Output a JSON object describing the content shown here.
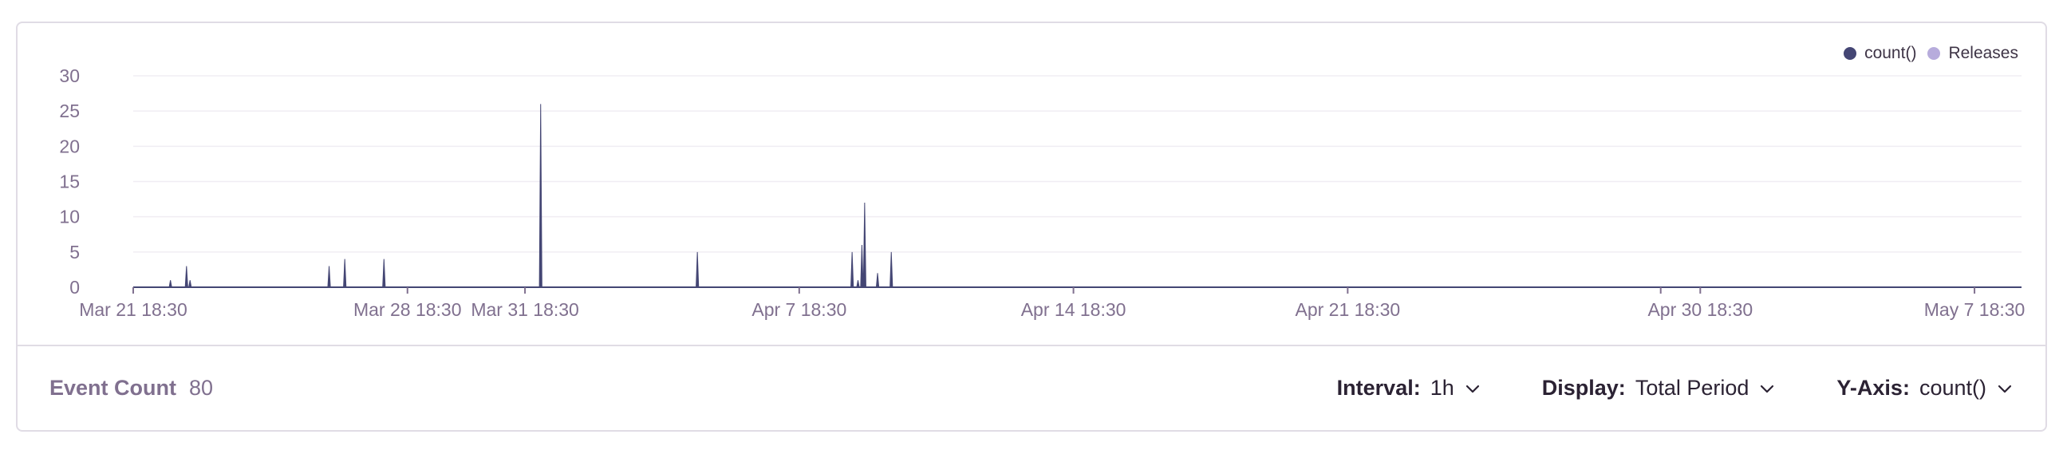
{
  "chart_data": {
    "type": "area",
    "title": "",
    "xlabel": "",
    "ylabel": "",
    "ylim": [
      0,
      30
    ],
    "y_ticks": [
      "30",
      "25",
      "20",
      "15",
      "10",
      "5",
      "0"
    ],
    "x_tick_labels": [
      "Mar 21 18:30",
      "Mar 28 18:30",
      "Mar 31 18:30",
      "Apr 7 18:30",
      "Apr 14 18:30",
      "Apr 21 18:30",
      "Apr 30 18:30",
      "May 7 18:30"
    ],
    "x_unit": "days since Mar 21 18:30",
    "x_tick_days": [
      0,
      7,
      10,
      17,
      24,
      31,
      40,
      47
    ],
    "x_range_days": [
      0,
      48.2
    ],
    "grid": true,
    "legend_position": "top-right",
    "series": [
      {
        "name": "count()",
        "color": "#444674",
        "points": [
          {
            "x": 0.95,
            "y": 1
          },
          {
            "x": 1.36,
            "y": 3
          },
          {
            "x": 1.45,
            "y": 1
          },
          {
            "x": 5.0,
            "y": 3
          },
          {
            "x": 5.4,
            "y": 4
          },
          {
            "x": 6.4,
            "y": 4
          },
          {
            "x": 10.4,
            "y": 26
          },
          {
            "x": 14.4,
            "y": 5
          },
          {
            "x": 18.35,
            "y": 5
          },
          {
            "x": 18.5,
            "y": 1
          },
          {
            "x": 18.6,
            "y": 6
          },
          {
            "x": 18.67,
            "y": 12
          },
          {
            "x": 19.0,
            "y": 2
          },
          {
            "x": 19.35,
            "y": 5
          }
        ]
      }
    ]
  },
  "legend": {
    "items": [
      {
        "label": "count()",
        "color": "#444674"
      },
      {
        "label": "Releases",
        "color": "#b7acdc"
      }
    ]
  },
  "footer": {
    "event_count_label": "Event Count",
    "event_count_value": "80",
    "interval_label": "Interval:",
    "interval_value": "1h",
    "display_label": "Display:",
    "display_value": "Total Period",
    "yaxis_label": "Y-Axis:",
    "yaxis_value": "count()"
  }
}
